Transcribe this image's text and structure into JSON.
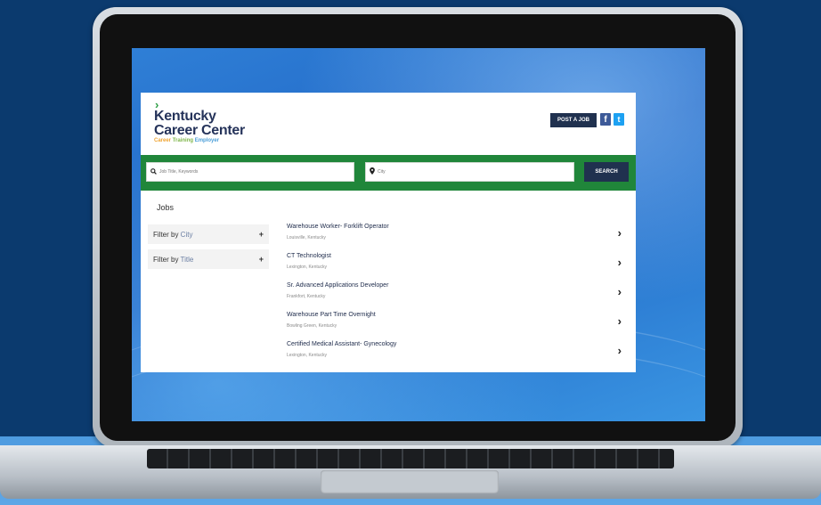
{
  "header": {
    "logo_line1": "Kentucky",
    "logo_line2": "Career Center",
    "tagline_parts": [
      "Career",
      "Training",
      "Employer"
    ],
    "post_job_label": "POST A JOB",
    "facebook_glyph": "f",
    "twitter_glyph": "t"
  },
  "search": {
    "keywords_placeholder": "Job Title, Keywords",
    "city_placeholder": "City",
    "button_label": "SEARCH"
  },
  "jobs_heading": "Jobs",
  "filters": [
    {
      "prefix": "Filter by ",
      "keyword": "City"
    },
    {
      "prefix": "Filter by ",
      "keyword": "Title"
    }
  ],
  "jobs": [
    {
      "title": "Warehouse Worker- Forklift Operator",
      "location": "Louisville, Kentucky"
    },
    {
      "title": "CT Technologist",
      "location": "Lexington, Kentucky"
    },
    {
      "title": "Sr. Advanced Applications Developer",
      "location": "Frankfort, Kentucky"
    },
    {
      "title": "Warehouse Part Time Overnight",
      "location": "Bowling Green, Kentucky"
    },
    {
      "title": "Certified Medical Assistant- Gynecology",
      "location": "Lexington, Kentucky"
    }
  ],
  "colors": {
    "brand_navy": "#20314f",
    "brand_green": "#20863a",
    "background": "#0b3a6e"
  },
  "icons": [
    "search-icon",
    "location-pin-icon",
    "chevron-right-icon",
    "plus-icon",
    "facebook-icon",
    "twitter-icon"
  ]
}
